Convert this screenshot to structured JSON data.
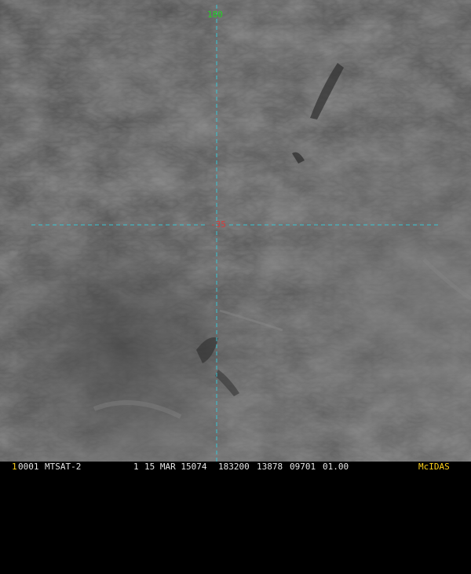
{
  "map": {
    "longitude_label": "180",
    "latitude_label": "-35"
  },
  "status_bar": {
    "frame_number": "1",
    "frame_id": "0001",
    "satellite": "MTSAT-2",
    "band": "1",
    "date": "15 MAR 15074",
    "time": "183200",
    "line": "13878",
    "element": "09701",
    "resolution": "01.00",
    "software": "McIDAS"
  },
  "colors": {
    "graticule": "#39c7d6",
    "longitude_label": "#22d122",
    "latitude_label": "#d83a3a",
    "software_tag": "#ffd21a",
    "status_text": "#e8e8e8"
  }
}
